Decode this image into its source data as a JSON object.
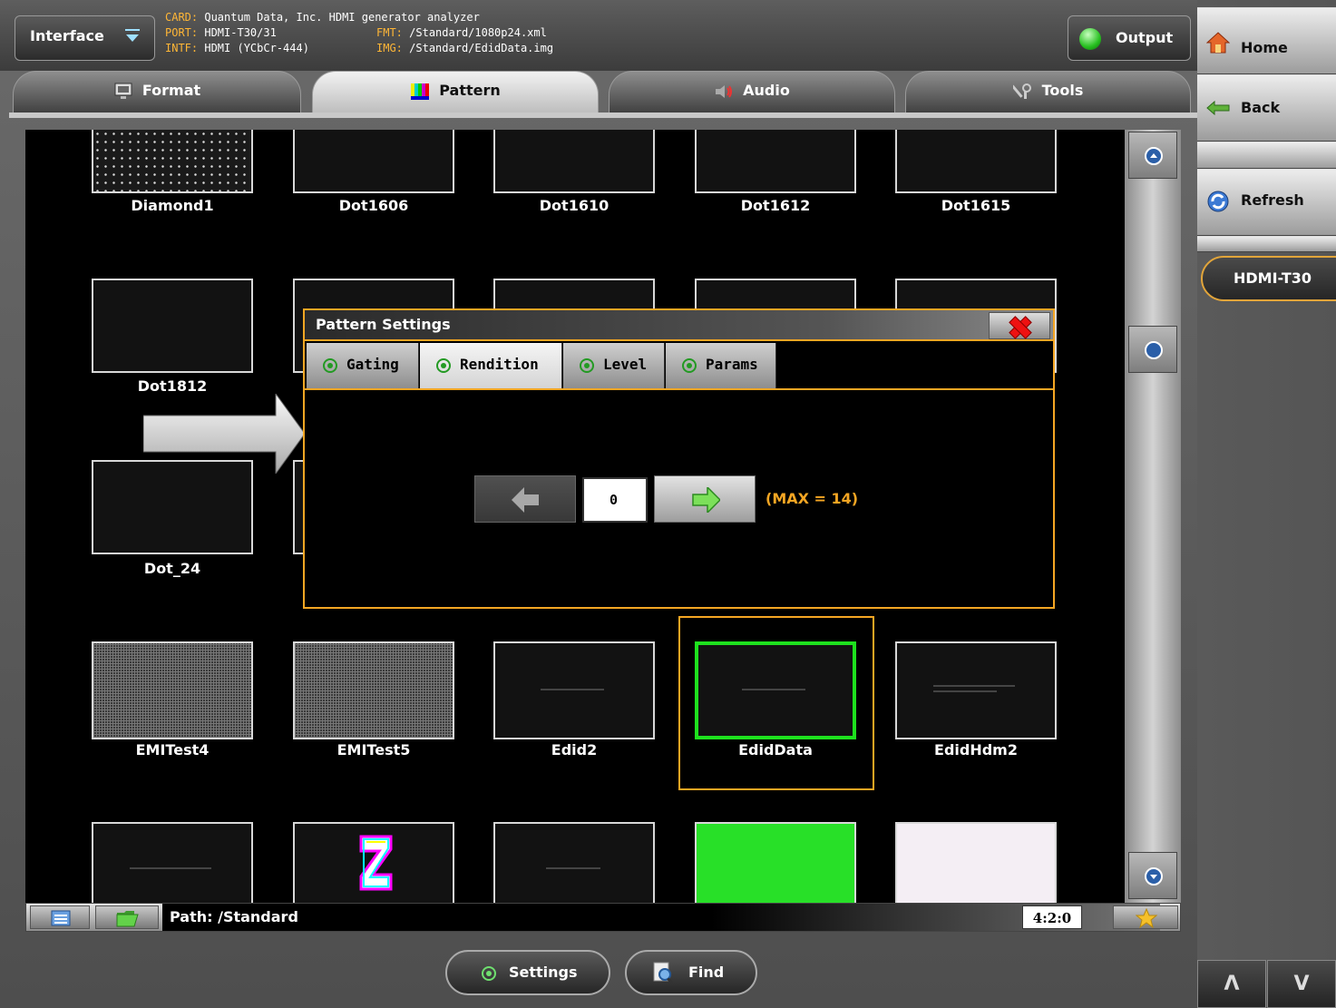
{
  "topbar": {
    "interface_label": "Interface",
    "output_label": "Output",
    "card_key": "CARD:",
    "card_val": "Quantum Data, Inc. HDMI generator analyzer",
    "port_key": "PORT:",
    "port_val": "HDMI-T30/31",
    "intf_key": "INTF:",
    "intf_val": "HDMI (YCbCr-444)",
    "fmt_key": "FMT:",
    "fmt_val": "/Standard/1080p24.xml",
    "img_key": "IMG:",
    "img_val": "/Standard/EdidData.img"
  },
  "tabs": [
    {
      "label": "Format",
      "icon": "monitor-icon",
      "active": false
    },
    {
      "label": "Pattern",
      "icon": "colorbars-icon",
      "active": true
    },
    {
      "label": "Audio",
      "icon": "speaker-icon",
      "active": false
    },
    {
      "label": "Tools",
      "icon": "tools-icon",
      "active": false
    }
  ],
  "patterns": [
    {
      "name": "Diamond1"
    },
    {
      "name": "Dot1606"
    },
    {
      "name": "Dot1610"
    },
    {
      "name": "Dot1612"
    },
    {
      "name": "Dot1615"
    },
    {
      "name": "Dot1812"
    },
    {
      "name": "Dot_24"
    },
    {
      "name": "EMITest4"
    },
    {
      "name": "EMITest5"
    },
    {
      "name": "Edid2"
    },
    {
      "name": "EdidData",
      "selected": true
    },
    {
      "name": "EdidHdm2"
    }
  ],
  "dialog": {
    "title": "Pattern Settings",
    "tabs": [
      "Gating",
      "Rendition",
      "Level",
      "Params"
    ],
    "active_tab": "Rendition",
    "value": "0",
    "max_text": "(MAX = 14)"
  },
  "pathbar": {
    "path": "Path: /Standard",
    "ratio": "4:2:0"
  },
  "bottom": {
    "settings_label": "Settings",
    "find_label": "Find"
  },
  "side": {
    "home_label": "Home",
    "back_label": "Back",
    "refresh_label": "Refresh",
    "device_label": "HDMI-T30"
  },
  "colors": {
    "accent": "#f5a623",
    "selection_green": "#1ee11e",
    "info_key": "#ffb636"
  }
}
